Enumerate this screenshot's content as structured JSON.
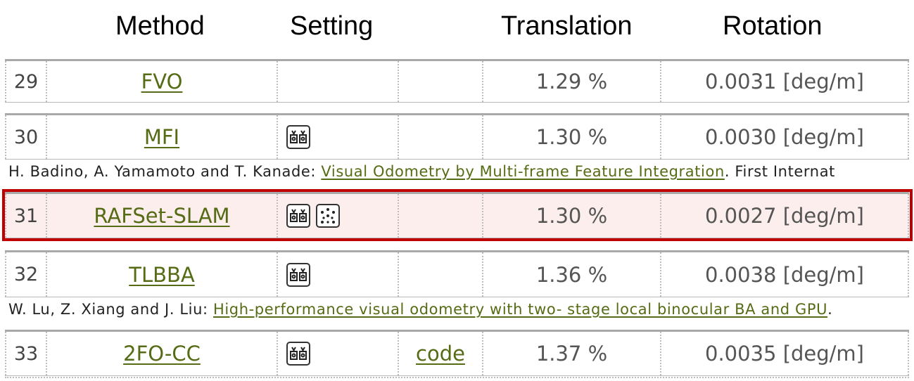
{
  "headers": {
    "method": "Method",
    "setting": "Setting",
    "translation": "Translation",
    "rotation": "Rotation"
  },
  "rows": [
    {
      "rank": "29",
      "method": "FVO",
      "setting_icons": [],
      "code": "",
      "translation": "1.29 %",
      "rotation": "0.0031 [deg/m]"
    },
    {
      "rank": "30",
      "method": "MFI",
      "setting_icons": [
        "stereo-camera-icon"
      ],
      "code": "",
      "translation": "1.30 %",
      "rotation": "0.0030 [deg/m]",
      "reference": {
        "authors": "H. Badino, A. Yamamoto and T. Kanade: ",
        "title": "Visual Odometry by Multi-frame Feature Integration",
        "rest": ". First Internat"
      }
    },
    {
      "rank": "31",
      "method": "RAFSet-SLAM",
      "setting_icons": [
        "stereo-camera-icon",
        "point-cloud-icon"
      ],
      "code": "",
      "translation": "1.30 %",
      "rotation": "0.0027 [deg/m]",
      "highlighted": true
    },
    {
      "rank": "32",
      "method": "TLBBA",
      "setting_icons": [
        "stereo-camera-icon"
      ],
      "code": "",
      "translation": "1.36 %",
      "rotation": "0.0038 [deg/m]",
      "reference": {
        "authors": "W. Lu, Z. Xiang and J. Liu: ",
        "title": "High-performance visual odometry with two- stage local binocular BA and GPU",
        "rest": "."
      }
    },
    {
      "rank": "33",
      "method": "2FO-CC",
      "setting_icons": [
        "stereo-camera-icon"
      ],
      "code": "code",
      "translation": "1.37 %",
      "rotation": "0.0035 [deg/m]"
    }
  ],
  "colors": {
    "link": "#556b14",
    "highlight_border": "#c00000",
    "highlight_background": "#fbeeed"
  }
}
